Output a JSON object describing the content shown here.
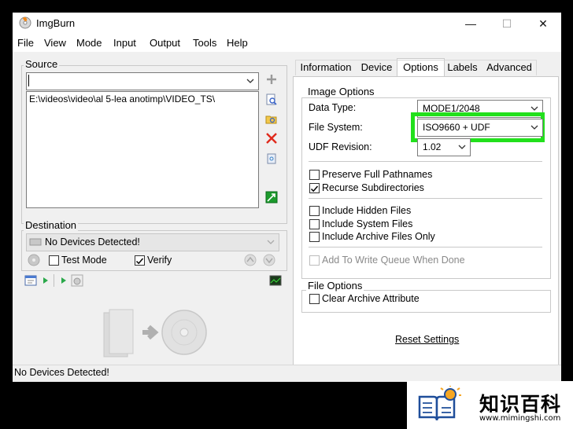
{
  "window": {
    "title": "ImgBurn",
    "controls": [
      "—",
      "☐",
      "✕"
    ]
  },
  "menu": [
    "File",
    "View",
    "Mode",
    "Input",
    "Output",
    "Tools",
    "Help"
  ],
  "source": {
    "label": "Source",
    "combo_value": "",
    "list_items": [
      "E:\\videos\\video\\al 5-lea anotimp\\VIDEO_TS\\"
    ]
  },
  "destination": {
    "label": "Destination",
    "device": "No Devices Detected!",
    "test_mode_label": "Test Mode",
    "test_mode_checked": false,
    "verify_label": "Verify",
    "verify_checked": true
  },
  "tabs": [
    {
      "label": "Information",
      "active": false
    },
    {
      "label": "Device",
      "active": false
    },
    {
      "label": "Options",
      "active": true
    },
    {
      "label": "Labels",
      "active": false
    },
    {
      "label": "Advanced",
      "active": false
    }
  ],
  "image_options": {
    "group_label": "Image Options",
    "data_type_label": "Data Type:",
    "data_type_value": "MODE1/2048",
    "file_system_label": "File System:",
    "file_system_value": "ISO9660 + UDF",
    "udf_revision_label": "UDF Revision:",
    "udf_revision_value": "1.02",
    "checkboxes": [
      {
        "label": "Preserve Full Pathnames",
        "checked": false,
        "enabled": true
      },
      {
        "label": "Recurse Subdirectories",
        "checked": true,
        "enabled": true
      },
      {
        "label": "Include Hidden Files",
        "checked": false,
        "enabled": true
      },
      {
        "label": "Include System Files",
        "checked": false,
        "enabled": true
      },
      {
        "label": "Include Archive Files Only",
        "checked": false,
        "enabled": true
      },
      {
        "label": "Add To Write Queue When Done",
        "checked": false,
        "enabled": false
      }
    ]
  },
  "file_options": {
    "group_label": "File Options",
    "clear_archive_label": "Clear Archive Attribute",
    "clear_archive_checked": false
  },
  "reset_settings_label": "Reset Settings",
  "status_bar": "No Devices Detected!",
  "highlight_color": "#22e01c",
  "watermark": {
    "brand": "知识百科",
    "url": "www.mimingshi.com"
  }
}
